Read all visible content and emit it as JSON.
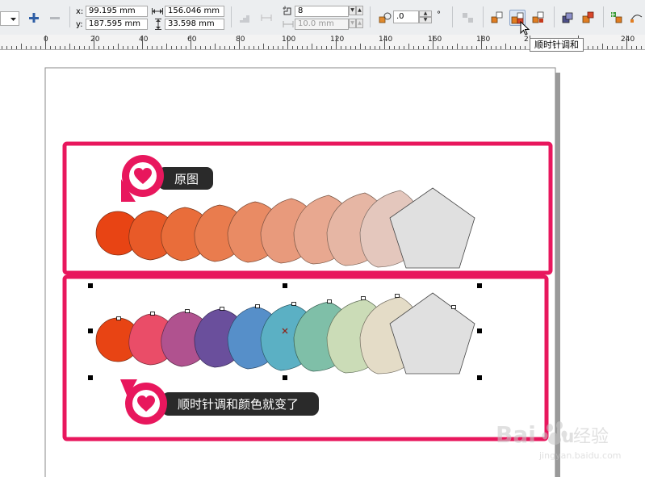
{
  "toolbar": {
    "x_label": "x:",
    "x_value": "99.195 mm",
    "y_label": "y:",
    "y_value": "187.595 mm",
    "width_value": "156.046 mm",
    "height_value": "33.598 mm",
    "steps_value": "8",
    "spacing_value": "10.0 mm",
    "angle_value": ".0",
    "degree_symbol": "°"
  },
  "ruler": {
    "labels": [
      "0",
      "20",
      "40",
      "60",
      "80",
      "100",
      "120",
      "140",
      "160",
      "180",
      "2",
      "240"
    ]
  },
  "tooltip": {
    "text": "顺时针调和"
  },
  "panels": {
    "original_label": "原图",
    "clockwise_label": "顺时针调和颜色就变了"
  },
  "colors": {
    "accent": "#e8175d",
    "badge": "#2a2a2a",
    "original_blend": [
      "#e84414",
      "#e85a28",
      "#e96d3a",
      "#e97c4e",
      "#e98b64",
      "#e89a7c",
      "#e8a890",
      "#e6b6a4",
      "#e4c7bd",
      "#e0e0e0"
    ],
    "clockwise_blend": [
      "#e84414",
      "#ea4d68",
      "#b0528f",
      "#6a4f9c",
      "#568fc9",
      "#5bb0c4",
      "#7fbfa8",
      "#cbdcb7",
      "#e4dcc7",
      "#e0e0e0"
    ]
  },
  "watermark": {
    "brand": "Bai",
    "brand2": "du",
    "cn": "经验",
    "url": "jingyan.baidu.com"
  }
}
